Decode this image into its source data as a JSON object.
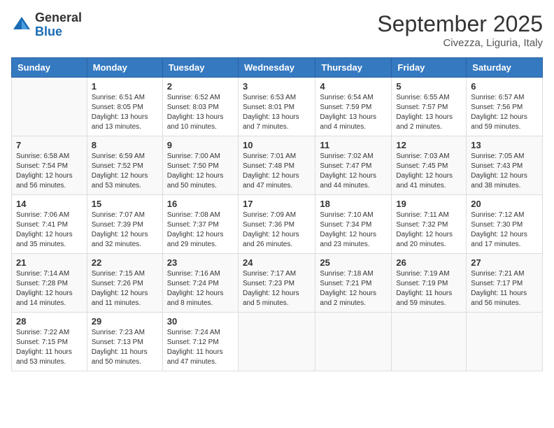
{
  "header": {
    "logo_general": "General",
    "logo_blue": "Blue",
    "month_title": "September 2025",
    "location": "Civezza, Liguria, Italy"
  },
  "days_of_week": [
    "Sunday",
    "Monday",
    "Tuesday",
    "Wednesday",
    "Thursday",
    "Friday",
    "Saturday"
  ],
  "weeks": [
    [
      {
        "day": "",
        "info": ""
      },
      {
        "day": "1",
        "info": "Sunrise: 6:51 AM\nSunset: 8:05 PM\nDaylight: 13 hours\nand 13 minutes."
      },
      {
        "day": "2",
        "info": "Sunrise: 6:52 AM\nSunset: 8:03 PM\nDaylight: 13 hours\nand 10 minutes."
      },
      {
        "day": "3",
        "info": "Sunrise: 6:53 AM\nSunset: 8:01 PM\nDaylight: 13 hours\nand 7 minutes."
      },
      {
        "day": "4",
        "info": "Sunrise: 6:54 AM\nSunset: 7:59 PM\nDaylight: 13 hours\nand 4 minutes."
      },
      {
        "day": "5",
        "info": "Sunrise: 6:55 AM\nSunset: 7:57 PM\nDaylight: 13 hours\nand 2 minutes."
      },
      {
        "day": "6",
        "info": "Sunrise: 6:57 AM\nSunset: 7:56 PM\nDaylight: 12 hours\nand 59 minutes."
      }
    ],
    [
      {
        "day": "7",
        "info": "Sunrise: 6:58 AM\nSunset: 7:54 PM\nDaylight: 12 hours\nand 56 minutes."
      },
      {
        "day": "8",
        "info": "Sunrise: 6:59 AM\nSunset: 7:52 PM\nDaylight: 12 hours\nand 53 minutes."
      },
      {
        "day": "9",
        "info": "Sunrise: 7:00 AM\nSunset: 7:50 PM\nDaylight: 12 hours\nand 50 minutes."
      },
      {
        "day": "10",
        "info": "Sunrise: 7:01 AM\nSunset: 7:48 PM\nDaylight: 12 hours\nand 47 minutes."
      },
      {
        "day": "11",
        "info": "Sunrise: 7:02 AM\nSunset: 7:47 PM\nDaylight: 12 hours\nand 44 minutes."
      },
      {
        "day": "12",
        "info": "Sunrise: 7:03 AM\nSunset: 7:45 PM\nDaylight: 12 hours\nand 41 minutes."
      },
      {
        "day": "13",
        "info": "Sunrise: 7:05 AM\nSunset: 7:43 PM\nDaylight: 12 hours\nand 38 minutes."
      }
    ],
    [
      {
        "day": "14",
        "info": "Sunrise: 7:06 AM\nSunset: 7:41 PM\nDaylight: 12 hours\nand 35 minutes."
      },
      {
        "day": "15",
        "info": "Sunrise: 7:07 AM\nSunset: 7:39 PM\nDaylight: 12 hours\nand 32 minutes."
      },
      {
        "day": "16",
        "info": "Sunrise: 7:08 AM\nSunset: 7:37 PM\nDaylight: 12 hours\nand 29 minutes."
      },
      {
        "day": "17",
        "info": "Sunrise: 7:09 AM\nSunset: 7:36 PM\nDaylight: 12 hours\nand 26 minutes."
      },
      {
        "day": "18",
        "info": "Sunrise: 7:10 AM\nSunset: 7:34 PM\nDaylight: 12 hours\nand 23 minutes."
      },
      {
        "day": "19",
        "info": "Sunrise: 7:11 AM\nSunset: 7:32 PM\nDaylight: 12 hours\nand 20 minutes."
      },
      {
        "day": "20",
        "info": "Sunrise: 7:12 AM\nSunset: 7:30 PM\nDaylight: 12 hours\nand 17 minutes."
      }
    ],
    [
      {
        "day": "21",
        "info": "Sunrise: 7:14 AM\nSunset: 7:28 PM\nDaylight: 12 hours\nand 14 minutes."
      },
      {
        "day": "22",
        "info": "Sunrise: 7:15 AM\nSunset: 7:26 PM\nDaylight: 12 hours\nand 11 minutes."
      },
      {
        "day": "23",
        "info": "Sunrise: 7:16 AM\nSunset: 7:24 PM\nDaylight: 12 hours\nand 8 minutes."
      },
      {
        "day": "24",
        "info": "Sunrise: 7:17 AM\nSunset: 7:23 PM\nDaylight: 12 hours\nand 5 minutes."
      },
      {
        "day": "25",
        "info": "Sunrise: 7:18 AM\nSunset: 7:21 PM\nDaylight: 12 hours\nand 2 minutes."
      },
      {
        "day": "26",
        "info": "Sunrise: 7:19 AM\nSunset: 7:19 PM\nDaylight: 11 hours\nand 59 minutes."
      },
      {
        "day": "27",
        "info": "Sunrise: 7:21 AM\nSunset: 7:17 PM\nDaylight: 11 hours\nand 56 minutes."
      }
    ],
    [
      {
        "day": "28",
        "info": "Sunrise: 7:22 AM\nSunset: 7:15 PM\nDaylight: 11 hours\nand 53 minutes."
      },
      {
        "day": "29",
        "info": "Sunrise: 7:23 AM\nSunset: 7:13 PM\nDaylight: 11 hours\nand 50 minutes."
      },
      {
        "day": "30",
        "info": "Sunrise: 7:24 AM\nSunset: 7:12 PM\nDaylight: 11 hours\nand 47 minutes."
      },
      {
        "day": "",
        "info": ""
      },
      {
        "day": "",
        "info": ""
      },
      {
        "day": "",
        "info": ""
      },
      {
        "day": "",
        "info": ""
      }
    ]
  ]
}
